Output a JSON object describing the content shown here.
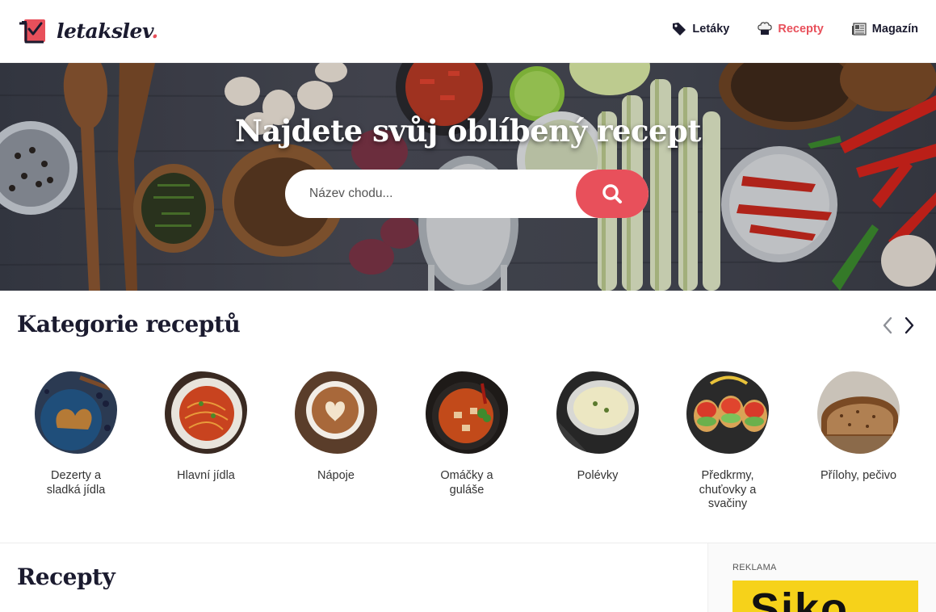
{
  "header": {
    "logo_text": "letakslev",
    "logo_dot": ".",
    "nav": [
      {
        "label": "Letáky",
        "icon": "tag-icon",
        "active": false
      },
      {
        "label": "Recepty",
        "icon": "chef-hat-icon",
        "active": true
      },
      {
        "label": "Magazín",
        "icon": "newspaper-icon",
        "active": false
      }
    ]
  },
  "hero": {
    "title": "Najdete svůj oblíbený recept",
    "search_placeholder": "Název chodu...",
    "search_icon": "search-icon"
  },
  "categories": {
    "title": "Kategorie receptů",
    "prev_icon": "chevron-left-icon",
    "next_icon": "chevron-right-icon",
    "items": [
      {
        "label": "Dezerty a sladká jídla"
      },
      {
        "label": "Hlavní jídla"
      },
      {
        "label": "Nápoje"
      },
      {
        "label": "Omáčky a guláše"
      },
      {
        "label": "Polévky"
      },
      {
        "label": "Předkrmy, chuťovky a svačiny"
      },
      {
        "label": "Přílohy, pečivo"
      }
    ]
  },
  "recipes": {
    "title": "Recepty"
  },
  "ad": {
    "label": "REKLAMA",
    "brand": "Siko"
  },
  "colors": {
    "accent": "#e8505b",
    "dark": "#1b1b2f",
    "ad_yellow": "#f6d21a"
  }
}
